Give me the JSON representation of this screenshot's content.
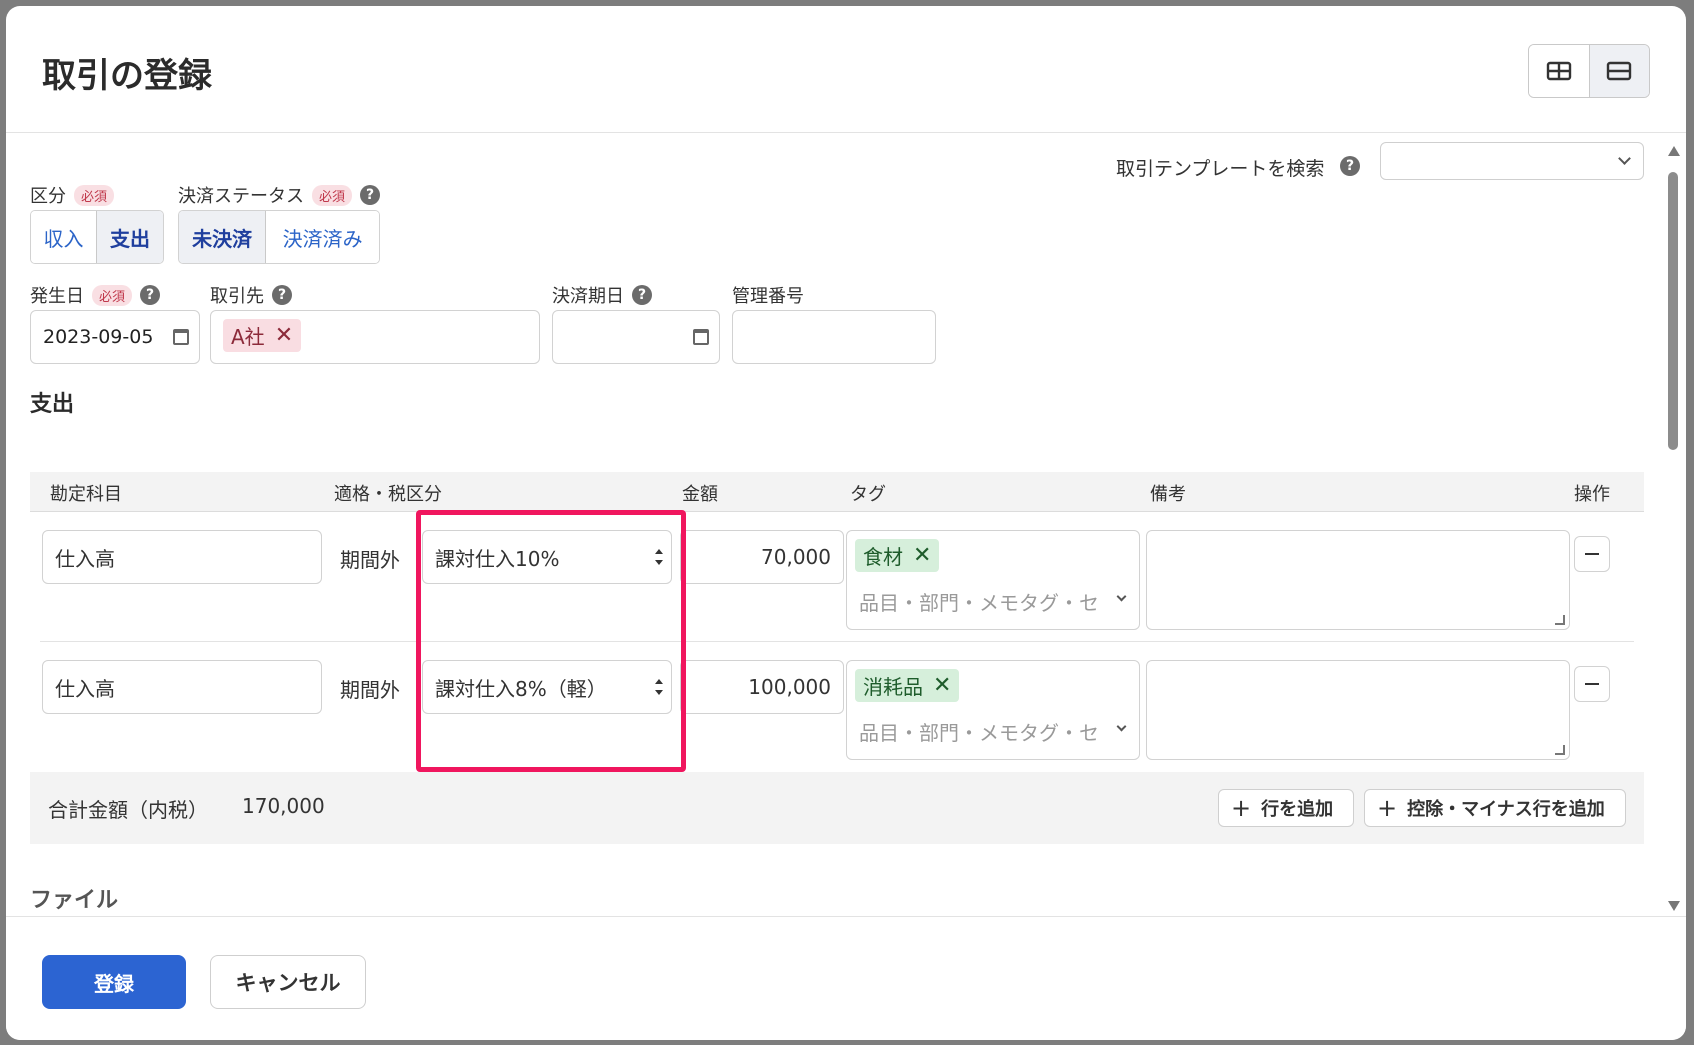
{
  "modal": {
    "title": "取引の登録",
    "view_toggle": [
      "split-view-icon",
      "stacked-view-icon"
    ]
  },
  "template": {
    "label": "取引テンプレートを検索",
    "help": "?",
    "value": ""
  },
  "category": {
    "label": "区分",
    "required": "必須",
    "options": [
      "収入",
      "支出"
    ],
    "selected": "支出"
  },
  "payment_status": {
    "label": "決済ステータス",
    "required": "必須",
    "help": "?",
    "options": [
      "未決済",
      "決済済み"
    ],
    "selected": "未決済"
  },
  "issue_date": {
    "label": "発生日",
    "required": "必須",
    "help": "?",
    "value": "2023-09-05"
  },
  "partner": {
    "label": "取引先",
    "help": "?",
    "chip": "A社",
    "remove": "✕"
  },
  "due_date": {
    "label": "決済期日",
    "help": "?",
    "value": ""
  },
  "ref_number": {
    "label": "管理番号",
    "value": ""
  },
  "expense": {
    "section_title": "支出",
    "columns": [
      "勘定科目",
      "適格・税区分",
      "金額",
      "タグ",
      "備考",
      "操作"
    ],
    "rows": [
      {
        "account": "仕入高",
        "qualified": "期間外",
        "tax": "課対仕入10%",
        "amount": "70,000",
        "tag": "食材",
        "tag_remove": "✕",
        "tag_placeholder": "品目・部門・メモタグ・セ",
        "note": ""
      },
      {
        "account": "仕入高",
        "qualified": "期間外",
        "tax": "課対仕入8%（軽）",
        "amount": "100,000",
        "tag": "消耗品",
        "tag_remove": "✕",
        "tag_placeholder": "品目・部門・メモタグ・セ",
        "note": ""
      }
    ],
    "total_label": "合計金額（内税）",
    "total_value": "170,000",
    "add_row": "行を追加",
    "add_minus_row": "控除・マイナス行を追加",
    "plus": "+"
  },
  "file_section": {
    "title": "ファイル"
  },
  "footer": {
    "submit": "登録",
    "cancel": "キャンセル"
  },
  "colors": {
    "primary": "#2c64d2",
    "highlight": "#f0165e",
    "required_badge": "#c0384b",
    "tag_green_bg": "#d6efdb",
    "chip_red_bg": "#f9dde2"
  }
}
